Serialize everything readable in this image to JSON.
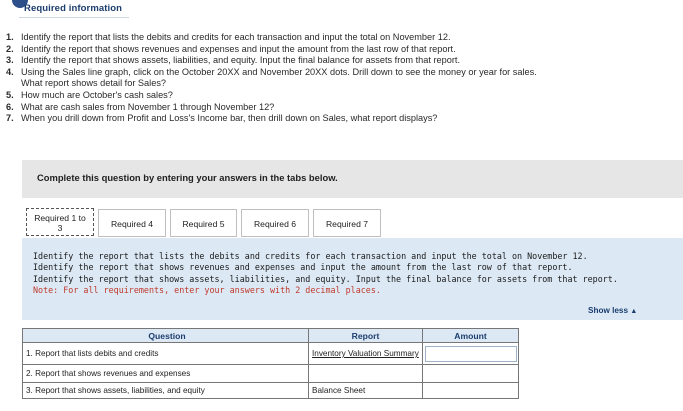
{
  "header": {
    "title": "Required information"
  },
  "requirements": [
    {
      "num": "1.",
      "text": "Identify the report that lists the debits and credits for each transaction and input the total on November 12."
    },
    {
      "num": "2.",
      "text": "Identify the report that shows revenues and expenses and input the amount from the last row of that report."
    },
    {
      "num": "3.",
      "text": "Identify the report that shows assets, liabilities, and equity. Input the final balance for assets from that report."
    },
    {
      "num": "4.",
      "text": "Using the Sales line graph, click on the October 20XX and November 20XX dots. Drill down to see the money or year for sales.",
      "cont": "What report shows detail for Sales?"
    },
    {
      "num": "5.",
      "text": "How much are October's cash sales?"
    },
    {
      "num": "6.",
      "text": "What are cash sales from November 1 through November 12?"
    },
    {
      "num": "7.",
      "text": "When you drill down from Profit and Loss's Income bar, then drill down on Sales, what report displays?"
    }
  ],
  "complete_bar": {
    "text": "Complete this question by entering your answers in the tabs below."
  },
  "tabs": [
    {
      "line1": "Required 1 to",
      "line2": "3"
    },
    {
      "label": "Required 4"
    },
    {
      "label": "Required 5"
    },
    {
      "label": "Required 6"
    },
    {
      "label": "Required 7"
    }
  ],
  "panel": {
    "lines": [
      "Identify the report that lists the debits and credits for each transaction and input the total on November 12.",
      "Identify the report that shows revenues and expenses and input the amount from the last row of that report.",
      "Identify the report that shows assets, liabilities, and equity. Input the final balance for assets from that report."
    ],
    "note": "Note: For all requirements, enter your answers with 2 decimal places."
  },
  "show_less": {
    "label": "Show less",
    "arrow": "▲"
  },
  "table": {
    "headers": {
      "question": "Question",
      "report": "Report",
      "amount": "Amount"
    },
    "rows": [
      {
        "question": "1. Report that lists debits and credits",
        "report": "Inventory Valuation Summary",
        "amount": ""
      },
      {
        "question": "2. Report that shows revenues and expenses",
        "report": "",
        "amount": ""
      },
      {
        "question": "3. Report that shows assets, liabilities, and equity",
        "report": "Balance Sheet",
        "amount": ""
      }
    ]
  }
}
